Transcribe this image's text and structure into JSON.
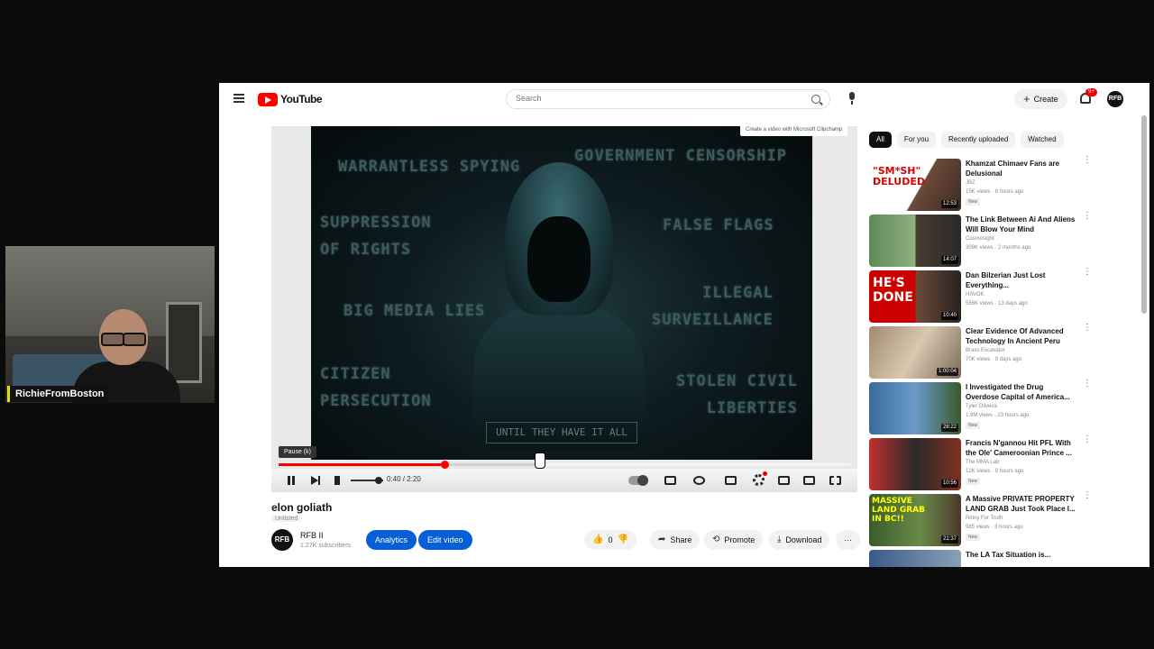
{
  "webcam": {
    "name": "RichieFromBoston"
  },
  "masthead": {
    "logo": "YouTube",
    "search_placeholder": "Search",
    "create_label": "Create",
    "notif_count": "9+",
    "avatar_text": "RFB"
  },
  "player": {
    "overlay_texts": {
      "t1": "WARRANTLESS SPYING",
      "t2": "GOVERNMENT CENSORSHIP",
      "t3": "SUPPRESSION\nOF RIGHTS",
      "t4": "FALSE FLAGS",
      "t5": "BIG MEDIA LIES",
      "t6": "ILLEGAL\nSURVEILLANCE",
      "t7": "CITIZEN\nPERSECUTION",
      "t8": "STOLEN CIVIL\nLIBERTIES"
    },
    "caption": "UNTIL THEY HAVE IT ALL",
    "clip_tooltip": "Create a video with Microsoft Clipchamp",
    "pause_tooltip": "Pause (k)",
    "time": "0:40 / 2:20",
    "progress_fraction": 0.29,
    "buffered_fraction": 0.45,
    "volume_fraction": 0.85
  },
  "video": {
    "title": "elon goliath",
    "visibility": "Unlisted",
    "channel_avatar": "RFB",
    "channel_name": "RFB II",
    "subscribers": "1.27K subscribers",
    "analytics_label": "Analytics",
    "edit_label": "Edit video",
    "likes": "0",
    "share_label": "Share",
    "promote_label": "Promote",
    "download_label": "Download",
    "more_label": "···"
  },
  "chips": [
    "All",
    "For you",
    "Recently uploaded",
    "Watched"
  ],
  "recommendations": [
    {
      "title": "Khamzat Chimaev Fans are Delusional",
      "channel": "JBZ",
      "meta": "15K views · 8 hours ago",
      "badge": "New",
      "duration": "12:53",
      "thumb_text": "\"SM*SH\" DELUDED"
    },
    {
      "title": "The Link Between Ai And Aliens Will Blow Your Mind",
      "channel": "Cosmosight",
      "meta": "309K views · 2 months ago",
      "badge": "",
      "duration": "14:07",
      "thumb_text": ""
    },
    {
      "title": "Dan Bilzerian Just Lost Everything...",
      "channel": "HAVOK",
      "meta": "586K views · 13 days ago",
      "badge": "",
      "duration": "10:40",
      "thumb_text": "HE'S DONE"
    },
    {
      "title": "Clear Evidence Of Advanced Technology In Ancient Peru An...",
      "channel": "Brass Excavator",
      "meta": "70K views · 9 days ago",
      "badge": "",
      "duration": "1:00:04",
      "thumb_text": ""
    },
    {
      "title": "I Investigated the Drug Overdose Capital of America...",
      "channel": "Tyler Oliveira",
      "meta": "1.9M views · 23 hours ago",
      "badge": "New",
      "duration": "28:22",
      "thumb_text": ""
    },
    {
      "title": "Francis N'gannou Hit PFL With the Ole' Cameroonian Prince ...",
      "channel": "The MMA Lab",
      "meta": "12K views · 9 hours ago",
      "badge": "New",
      "duration": "10:56",
      "thumb_text": ""
    },
    {
      "title": "A Massive PRIVATE PROPERTY LAND GRAB Just Took Place I...",
      "channel": "Rinny For Truth",
      "meta": "985 views · 3 hours ago",
      "badge": "New",
      "duration": "21:37",
      "thumb_text": "MASSIVE LAND GRAB IN BC!!"
    },
    {
      "title": "The LA Tax Situation is...",
      "channel": "",
      "meta": "",
      "badge": "",
      "duration": "",
      "thumb_text": ""
    }
  ]
}
